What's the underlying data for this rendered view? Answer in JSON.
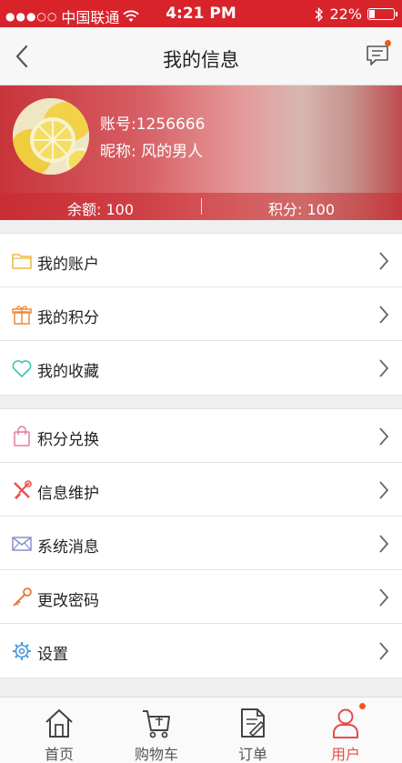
{
  "status_bar": {
    "signal": "●●●○○",
    "carrier": "中国联通",
    "time": "4:21 PM",
    "battery": "22%"
  },
  "nav": {
    "title": "我的信息"
  },
  "profile": {
    "account": "账号:1256666",
    "nickname": "昵称: 风的男人",
    "balance": "余额: 100",
    "points": "积分: 100"
  },
  "menu_group_1": [
    {
      "label": "我的账户",
      "icon": "folder-icon"
    },
    {
      "label": "我的积分",
      "icon": "gift-icon"
    },
    {
      "label": "我的收藏",
      "icon": "heart-icon"
    }
  ],
  "menu_group_2": [
    {
      "label": "积分兑换",
      "icon": "bag-icon"
    },
    {
      "label": "信息维护",
      "icon": "tools-icon"
    },
    {
      "label": "系统消息",
      "icon": "envelope-icon"
    },
    {
      "label": "更改密码",
      "icon": "key-icon"
    },
    {
      "label": "设置",
      "icon": "gear-icon"
    }
  ],
  "tab_bar": [
    {
      "label": "首页",
      "icon": "home-icon"
    },
    {
      "label": "购物车",
      "icon": "cart-icon"
    },
    {
      "label": "订单",
      "icon": "order-icon"
    },
    {
      "label": "用户",
      "icon": "user-icon",
      "active": true
    }
  ],
  "colors": {
    "brand_red": "#d8232b",
    "active_tab": "#e84b4b",
    "badge_dot": "#f05a1a"
  }
}
